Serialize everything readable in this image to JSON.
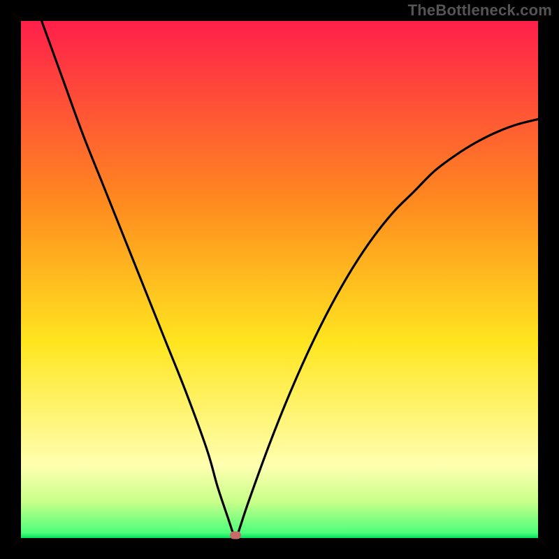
{
  "watermark": "TheBottleneck.com",
  "colors": {
    "gradient_top": "#ff1f4b",
    "gradient_mid1": "#ff8a1f",
    "gradient_mid2": "#ffe51f",
    "gradient_mid3": "#ffff8a",
    "gradient_bottom": "#00e05a",
    "curve": "#000000",
    "marker": "#c76a6a",
    "frame_bg": "#000000"
  },
  "chart_data": {
    "type": "line",
    "title": "",
    "xlabel": "",
    "ylabel": "",
    "xlim": [
      0,
      100
    ],
    "ylim": [
      0,
      100
    ],
    "grid": false,
    "series": [
      {
        "name": "bottleneck-curve",
        "x": [
          4,
          8,
          12,
          16,
          20,
          24,
          28,
          32,
          36,
          38,
          40,
          41,
          41.5,
          42,
          44,
          48,
          52,
          56,
          60,
          64,
          68,
          72,
          76,
          80,
          84,
          88,
          92,
          96,
          100
        ],
        "y": [
          100,
          89,
          78,
          68,
          58,
          48,
          38,
          28,
          17,
          10,
          4,
          1,
          0,
          1,
          7,
          18,
          28,
          37,
          45,
          52,
          58,
          63,
          67,
          71,
          74,
          76.5,
          78.5,
          80,
          81
        ]
      }
    ],
    "marker": {
      "x": 41.5,
      "y": 0.5
    },
    "gradient_stops_pct": [
      0,
      35,
      62,
      86,
      93,
      99,
      100
    ],
    "gradient_colors": [
      "#ff1f4b",
      "#ff8a1f",
      "#ffe51f",
      "#ffffb0",
      "#c8ff8a",
      "#4dff7a",
      "#00e05a"
    ]
  }
}
